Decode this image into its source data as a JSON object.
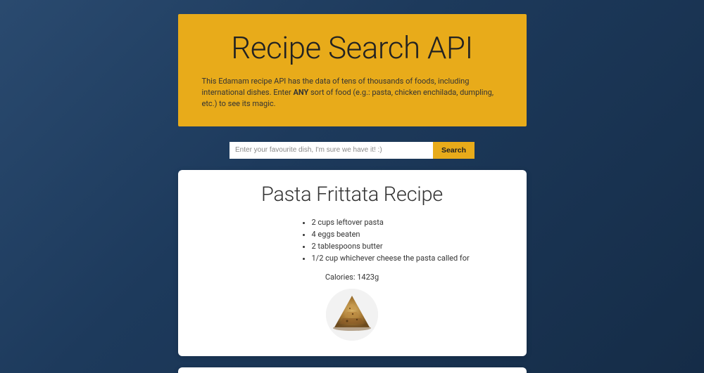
{
  "header": {
    "title": "Recipe Search API",
    "desc_pre": "This Edamam recipe API has the data of tens of thousands of foods, including international dishes. Enter ",
    "desc_bold": "ANY",
    "desc_post": " sort of food (e.g.: pasta, chicken enchilada, dumpling, etc.) to see its magic."
  },
  "search": {
    "placeholder": "Enter your favourite dish, I'm sure we have it! :)",
    "value": "",
    "button_label": "Search"
  },
  "recipe": {
    "title": "Pasta Frittata Recipe",
    "ingredients": [
      "2 cups leftover pasta",
      "4 eggs beaten",
      "2 tablespoons butter",
      "1/2 cup whichever cheese the pasta called for"
    ],
    "calories_label": "Calories: 1423g"
  }
}
